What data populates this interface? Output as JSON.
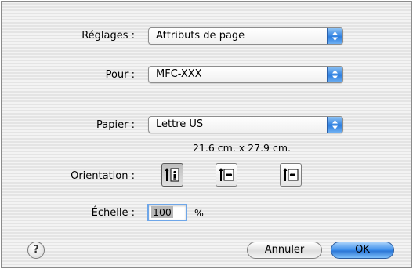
{
  "labels": {
    "settings": "Réglages :",
    "for": "Pour :",
    "paper": "Papier :",
    "orientation": "Orientation :",
    "scale": "Échelle :"
  },
  "popups": {
    "settings_value": "Attributs de page",
    "for_value": "MFC-XXX",
    "paper_value": "Lettre US"
  },
  "paper_dimensions": "21.6 cm. x 27.9 cm.",
  "orientation": {
    "options": [
      "portrait",
      "landscape",
      "landscape-reversed"
    ],
    "selected": "portrait"
  },
  "scale": {
    "value": "100",
    "unit": "%"
  },
  "help_label": "?",
  "buttons": {
    "cancel": "Annuler",
    "ok": "OK"
  },
  "colors": {
    "accent": "#3a8cea",
    "background": "#ececec"
  }
}
